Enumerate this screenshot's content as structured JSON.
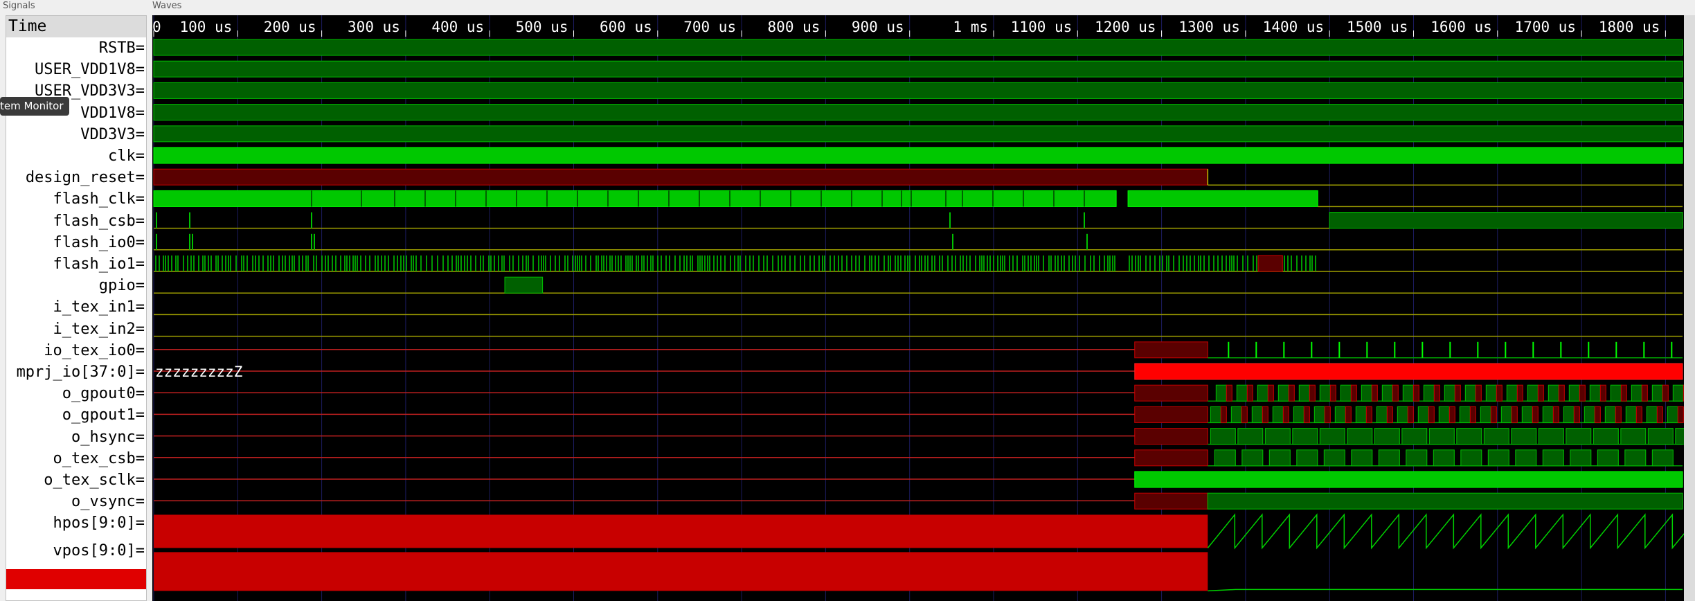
{
  "panels": {
    "signals_title": "Signals",
    "waves_title": "Waves"
  },
  "time_header": "Time",
  "tooltip": "tem Monitor",
  "timeline": {
    "ticks": [
      "0",
      "100 us",
      "200 us",
      "300 us",
      "400 us",
      "500 us",
      "600 us",
      "700 us",
      "800 us",
      "900 us",
      "1 ms",
      "1100 us",
      "1200 us",
      "1300 us",
      "1400 us",
      "1500 us",
      "1600 us",
      "1700 us",
      "1800 us"
    ]
  },
  "signals": [
    {
      "name": "RSTB="
    },
    {
      "name": "USER_VDD1V8="
    },
    {
      "name": "USER_VDD3V3="
    },
    {
      "name": "VDD1V8="
    },
    {
      "name": "VDD3V3="
    },
    {
      "name": "clk="
    },
    {
      "name": "design_reset="
    },
    {
      "name": "flash_clk="
    },
    {
      "name": "flash_csb="
    },
    {
      "name": "flash_io0="
    },
    {
      "name": "flash_io1="
    },
    {
      "name": "gpio="
    },
    {
      "name": "i_tex_in1="
    },
    {
      "name": "i_tex_in2="
    },
    {
      "name": "io_tex_io0="
    },
    {
      "name": "mprj_io[37:0]="
    },
    {
      "name": "o_gpout0="
    },
    {
      "name": "o_gpout1="
    },
    {
      "name": "o_hsync="
    },
    {
      "name": "o_tex_csb="
    },
    {
      "name": "o_tex_sclk="
    },
    {
      "name": "o_vsync="
    },
    {
      "name": "hpos[9:0]="
    },
    {
      "name": "vpos[9:0]="
    }
  ],
  "mprj_value": "zzzzzzzzzZ",
  "colors": {
    "high": "#006000",
    "high_edge": "#00c000",
    "bright": "#00d000",
    "low": "#a0a000",
    "x_fill": "#c80000",
    "x_dark": "#5a0000",
    "z_line": "#c02020",
    "grid": "#1c1c60"
  }
}
